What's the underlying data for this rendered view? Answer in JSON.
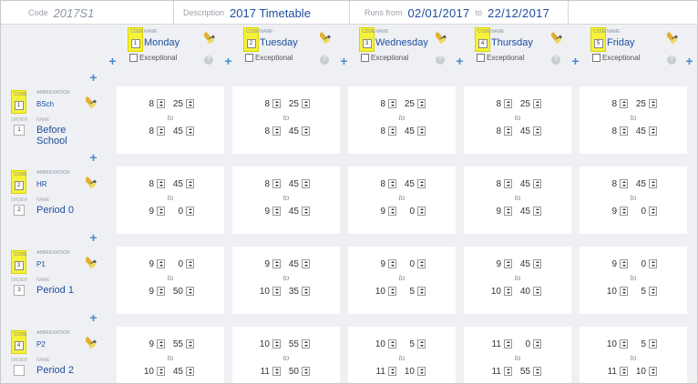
{
  "header": {
    "code_label": "Code",
    "code_value": "2017S1",
    "description_label": "Description",
    "description_value": "2017 Timetable",
    "runs_from_label": "Runs from",
    "runs_from_value": "02/01/2017",
    "to_label": "to",
    "runs_to_value": "22/12/2017"
  },
  "labels": {
    "code": "CODE",
    "name": "NAME",
    "abbreviation": "ABBREVIATION",
    "order": "ORDER",
    "exceptional": "Exceptional",
    "to": "to",
    "help": "?",
    "plus": "+"
  },
  "days": [
    {
      "code": "1",
      "name": "Monday"
    },
    {
      "code": "2",
      "name": "Tuesday"
    },
    {
      "code": "3",
      "name": "Wednesday"
    },
    {
      "code": "4",
      "name": "Thursday"
    },
    {
      "code": "5",
      "name": "Friday"
    }
  ],
  "periods": [
    {
      "code": "1",
      "abbreviation": "BSch",
      "order": "1",
      "name": "Before School"
    },
    {
      "code": "2",
      "abbreviation": "HR",
      "order": "2",
      "name": "Period 0"
    },
    {
      "code": "3",
      "abbreviation": "P1",
      "order": "3",
      "name": "Period 1"
    },
    {
      "code": "4",
      "abbreviation": "P2",
      "order": "",
      "name": "Period 2"
    }
  ],
  "times": [
    [
      [
        "8",
        "25",
        "8",
        "45"
      ],
      [
        "8",
        "25",
        "8",
        "45"
      ],
      [
        "8",
        "25",
        "8",
        "45"
      ],
      [
        "8",
        "25",
        "8",
        "45"
      ],
      [
        "8",
        "25",
        "8",
        "45"
      ]
    ],
    [
      [
        "8",
        "45",
        "9",
        "0"
      ],
      [
        "8",
        "45",
        "9",
        "45"
      ],
      [
        "8",
        "45",
        "9",
        "0"
      ],
      [
        "8",
        "45",
        "9",
        "45"
      ],
      [
        "8",
        "45",
        "9",
        "0"
      ]
    ],
    [
      [
        "9",
        "0",
        "9",
        "50"
      ],
      [
        "9",
        "45",
        "10",
        "35"
      ],
      [
        "9",
        "0",
        "10",
        "5"
      ],
      [
        "9",
        "45",
        "10",
        "40"
      ],
      [
        "9",
        "0",
        "10",
        "5"
      ]
    ],
    [
      [
        "9",
        "55",
        "10",
        "45"
      ],
      [
        "10",
        "55",
        "11",
        "50"
      ],
      [
        "10",
        "5",
        "11",
        "10"
      ],
      [
        "11",
        "0",
        "11",
        "55"
      ],
      [
        "10",
        "5",
        "11",
        "10"
      ]
    ]
  ],
  "colors": {
    "accent": "#1f4fa0",
    "code_box": "#f5f23a",
    "background": "#eef0f3"
  }
}
